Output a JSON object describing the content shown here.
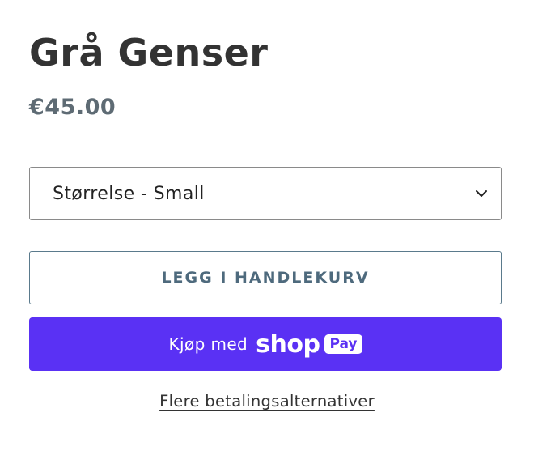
{
  "product": {
    "title": "Grå Genser",
    "price": "€45.00"
  },
  "variant_select": {
    "selected": "Størrelse - Small",
    "icon": "chevron-down-icon"
  },
  "buttons": {
    "add_to_cart": "LEGG I HANDLEKURV",
    "shop_pay_prefix": "Kjøp med",
    "shop_pay_brand": "shop",
    "shop_pay_badge": "Pay",
    "shop_pay_color": "#5a31f4",
    "more_payment_options": "Flere betalingsalternativer"
  }
}
